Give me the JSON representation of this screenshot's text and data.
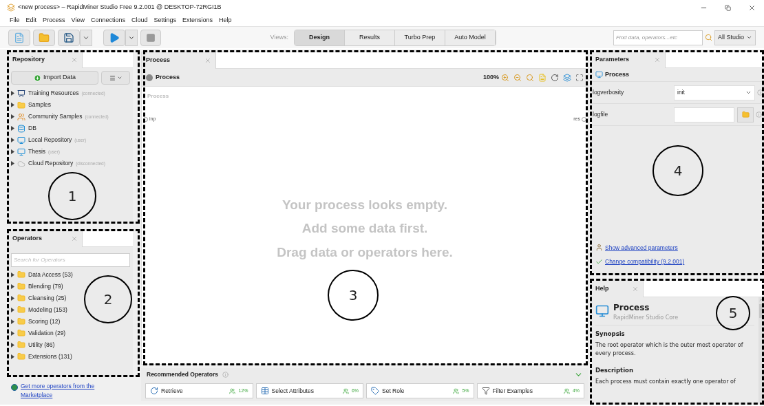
{
  "window": {
    "title": "<new process> – RapidMiner Studio Free 9.2.001 @ DESKTOP-72RGI1B"
  },
  "menu": [
    "File",
    "Edit",
    "Process",
    "View",
    "Connections",
    "Cloud",
    "Settings",
    "Extensions",
    "Help"
  ],
  "views": {
    "label": "Views:",
    "tabs": [
      {
        "label": "Design",
        "selected": true
      },
      {
        "label": "Results",
        "selected": false
      },
      {
        "label": "Turbo Prep",
        "selected": false
      },
      {
        "label": "Auto Model",
        "selected": false
      }
    ]
  },
  "search": {
    "placeholder": "Find data, operators...etc"
  },
  "scope": "All Studio",
  "repository": {
    "tab": "Repository",
    "import_button": "Import Data",
    "items": [
      {
        "kind": "training",
        "name": "Training Resources",
        "note": "(connected)"
      },
      {
        "kind": "folder",
        "name": "Samples"
      },
      {
        "kind": "community",
        "name": "Community Samples",
        "note": "(connected)"
      },
      {
        "kind": "db",
        "name": "DB"
      },
      {
        "kind": "local",
        "name": "Local Repository",
        "note": "(user)"
      },
      {
        "kind": "local",
        "name": "Thesis",
        "note": "(user)"
      },
      {
        "kind": "cloud",
        "name": "Cloud Repository",
        "note": "(disconnected)"
      }
    ]
  },
  "operators": {
    "tab": "Operators",
    "placeholder": "Search for Operators",
    "items": [
      {
        "name": "Data Access",
        "count": "(53)"
      },
      {
        "name": "Blending",
        "count": "(79)"
      },
      {
        "name": "Cleansing",
        "count": "(25)"
      },
      {
        "name": "Modeling",
        "count": "(153)"
      },
      {
        "name": "Scoring",
        "count": "(12)"
      },
      {
        "name": "Validation",
        "count": "(29)"
      },
      {
        "name": "Utility",
        "count": "(86)"
      },
      {
        "name": "Extensions",
        "count": "(131)"
      }
    ],
    "marketplace_link": "Get more operators from the Marketplace"
  },
  "process": {
    "tab": "Process",
    "breadcrumb": "Process",
    "zoom": "100%",
    "canvas_label": "Process",
    "input_port": "inp",
    "result_port": "res",
    "empty_message": [
      "Your process looks empty.",
      "Add some data first.",
      "Drag data or operators here."
    ]
  },
  "recommended": {
    "title": "Recommended Operators",
    "items": [
      {
        "kind": "retrieve",
        "name": "Retrieve",
        "share": "12%"
      },
      {
        "kind": "attributes",
        "name": "Select Attributes",
        "share": "6%"
      },
      {
        "kind": "role",
        "name": "Set Role",
        "share": "5%"
      },
      {
        "kind": "filter",
        "name": "Filter Examples",
        "share": "4%"
      }
    ]
  },
  "parameters": {
    "tab": "Parameters",
    "operator": "Process",
    "rows": [
      {
        "kind": "select",
        "name": "logverbosity",
        "value": "init"
      },
      {
        "kind": "file",
        "name": "logfile"
      }
    ],
    "advanced_link": "Show advanced parameters",
    "compat_link": "Change compatibility (9.2.001)"
  },
  "help": {
    "tab": "Help",
    "title": "Process",
    "subtitle": "RapidMiner Studio Core",
    "sections": [
      {
        "heading": "Synopsis",
        "text": "The root operator which is the outer most operator of every process."
      },
      {
        "heading": "Description",
        "text": "Each process must contain exactly one operator of"
      }
    ]
  },
  "annotations": [
    {
      "label": "1"
    },
    {
      "label": "2"
    },
    {
      "label": "3"
    },
    {
      "label": "4"
    },
    {
      "label": "5"
    }
  ]
}
